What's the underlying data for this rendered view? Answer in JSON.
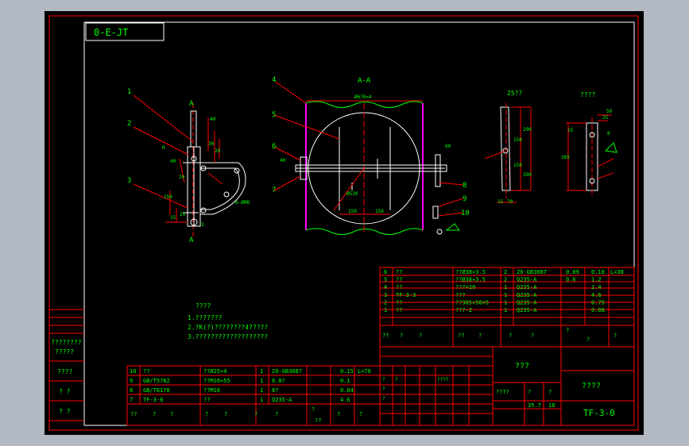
{
  "window": {
    "background": "#b3b9c2",
    "canvas": "#000000",
    "frame_color": "#ff0000",
    "text_color": "#00ff00",
    "line_color": "#ffffff",
    "magenta": "#ff00ff"
  },
  "drawing": {
    "stamp": "0-E-JT",
    "title": "TF-3-0",
    "company": "????",
    "name_cell": "???",
    "scale": "1:1",
    "approve": "????",
    "stage_labels": [
      "?",
      "?",
      "?",
      "?",
      "????",
      "?",
      "?"
    ],
    "weight": "35.7",
    "ratio": "18",
    "row_labels_left": [
      "????????",
      "?????",
      "????",
      "?  ?",
      "?  ?"
    ]
  },
  "views": {
    "section_label": "A-A",
    "section_marker_top": "A",
    "section_marker_bottom": "A",
    "side_label": "25??",
    "detail_label": "????",
    "balloons": [
      "1",
      "2",
      "3",
      "4",
      "5",
      "6",
      "7",
      "8",
      "9",
      "10"
    ],
    "dims_left": [
      "40",
      "30",
      "20",
      "R",
      "40",
      "20",
      "15",
      "20",
      "150",
      "3",
      "6-ØM8"
    ],
    "dims_section": [
      "Ø670×4",
      "60",
      "40",
      "150",
      "150",
      "Ø530",
      "60"
    ],
    "dims_side": [
      "290",
      "150",
      "150",
      "290",
      "15",
      "70"
    ],
    "dims_detail": [
      "50",
      "25",
      "385",
      "15",
      "8"
    ]
  },
  "notes": {
    "title": "????",
    "lines": [
      "1.???????",
      "2.?K(?)????????4?????",
      "3.???????????????????"
    ]
  },
  "bom_right": {
    "rows": [
      [
        "6",
        "??",
        "??Ø38×3.5",
        "2",
        "20-GB3087",
        "0.09",
        "0.18",
        "L=30"
      ],
      [
        "5",
        "??",
        "??Ø38×3.5",
        "2",
        "Q235-A",
        "0.6",
        "1.2",
        ""
      ],
      [
        "4",
        "??",
        "???=10",
        "1",
        "Q235-A",
        "",
        "2.4",
        ""
      ],
      [
        "3",
        "TF-3-3",
        "???",
        "1",
        "Q235-A",
        "",
        "4.6",
        ""
      ],
      [
        "2",
        "??",
        "??385×50×5",
        "1",
        "Q235-A",
        "",
        "0.75",
        ""
      ],
      [
        "1",
        "??",
        "???-2",
        "1",
        "Q235-A",
        "",
        "0.08",
        ""
      ]
    ],
    "header": [
      "??",
      "?",
      "?",
      "??",
      "?",
      "?",
      "?",
      "?",
      "?",
      "?"
    ]
  },
  "bom_left": {
    "rows": [
      [
        "10",
        "??",
        "??Ø25×4",
        "1",
        "20-GB3087",
        "0.15",
        "L=70"
      ],
      [
        "9",
        "GB/T5782",
        "??M16×55",
        "1",
        "8.8?",
        "0.1",
        ""
      ],
      [
        "8",
        "GB/T6170",
        "??M16",
        "1",
        "8?",
        "0.04",
        ""
      ],
      [
        "7",
        "TF-3-8",
        "??",
        "1",
        "Q235-A",
        "4.6",
        ""
      ]
    ],
    "footer": [
      "??",
      "?",
      "?",
      "?",
      "?",
      "?",
      "?",
      "?",
      "??",
      "?",
      "?"
    ]
  }
}
